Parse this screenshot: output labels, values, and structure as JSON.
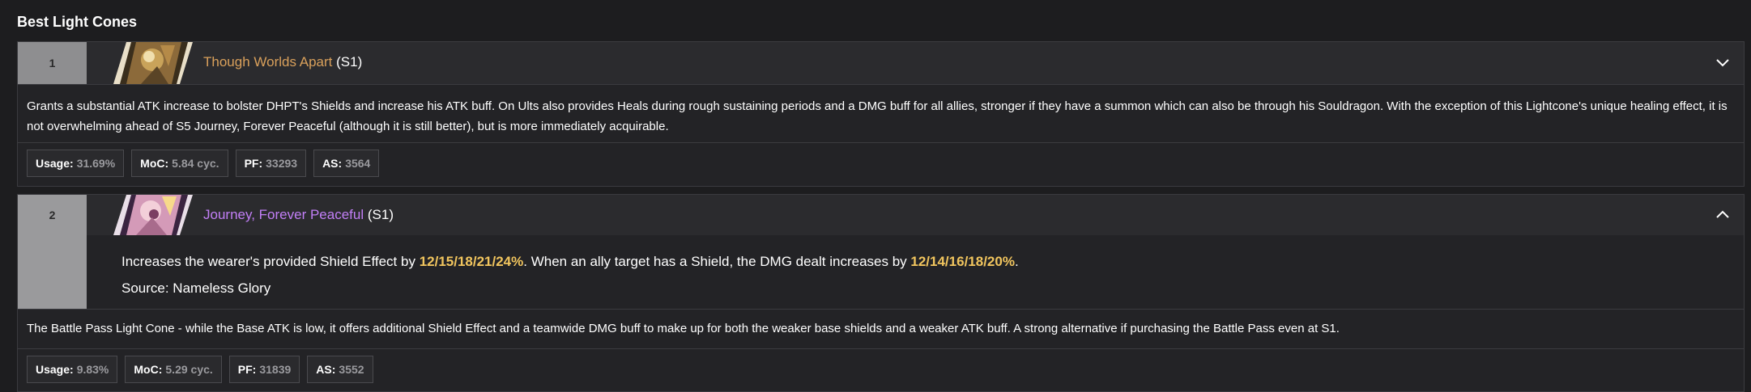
{
  "section": {
    "title": "Best Light Cones"
  },
  "cones": [
    {
      "rank": "1",
      "name": "Though Worlds Apart",
      "superimposition": "(S1)",
      "expanded": false,
      "description": "Grants a substantial ATK increase to bolster DHPT's Shields and increase his ATK buff. On Ults also provides Heals during rough sustaining periods and a DMG buff for all allies, stronger if they have a summon which can also be through his Souldragon. With the exception of this Lightcone's unique healing effect, it is not overwhelming ahead of S5 Journey, Forever Peaceful (although it is still better), but is more immediately acquirable.",
      "stats": [
        {
          "label": "Usage:",
          "value": "31.69%"
        },
        {
          "label": "MoC:",
          "value": "5.84 cyc."
        },
        {
          "label": "PF:",
          "value": "33293"
        },
        {
          "label": "AS:",
          "value": "3564"
        }
      ],
      "name_color": "#d9a05b",
      "toggle_icon": "chevron-down-icon"
    },
    {
      "rank": "2",
      "name": "Journey, Forever Peaceful",
      "superimposition": "(S1)",
      "expanded": true,
      "effect": {
        "part1": "Increases the wearer's provided Shield Effect by ",
        "value1": "12/15/18/21/24%",
        "part2": ". When an ally target has a Shield, the DMG dealt increases by ",
        "value2": "12/14/16/18/20%",
        "part3": "."
      },
      "source": "Source: Nameless Glory",
      "description": "The Battle Pass Light Cone - while the Base ATK is low, it offers additional Shield Effect and a teamwide DMG buff to make up for both the weaker base shields and a weaker ATK buff. A strong alternative if purchasing the Battle Pass even at S1.",
      "stats": [
        {
          "label": "Usage:",
          "value": "9.83%"
        },
        {
          "label": "MoC:",
          "value": "5.29 cyc."
        },
        {
          "label": "PF:",
          "value": "31839"
        },
        {
          "label": "AS:",
          "value": "3552"
        }
      ],
      "name_color": "#c27ff7",
      "toggle_icon": "chevron-up-icon"
    }
  ]
}
